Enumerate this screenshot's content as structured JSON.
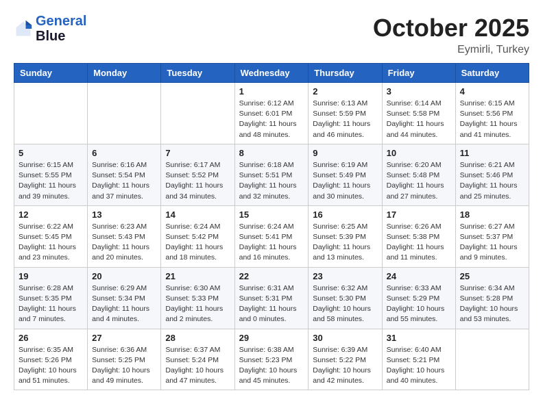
{
  "header": {
    "logo_line1": "General",
    "logo_line2": "Blue",
    "month": "October 2025",
    "location": "Eymirli, Turkey"
  },
  "weekdays": [
    "Sunday",
    "Monday",
    "Tuesday",
    "Wednesday",
    "Thursday",
    "Friday",
    "Saturday"
  ],
  "weeks": [
    [
      {
        "day": "",
        "info": ""
      },
      {
        "day": "",
        "info": ""
      },
      {
        "day": "",
        "info": ""
      },
      {
        "day": "1",
        "info": "Sunrise: 6:12 AM\nSunset: 6:01 PM\nDaylight: 11 hours and 48 minutes."
      },
      {
        "day": "2",
        "info": "Sunrise: 6:13 AM\nSunset: 5:59 PM\nDaylight: 11 hours and 46 minutes."
      },
      {
        "day": "3",
        "info": "Sunrise: 6:14 AM\nSunset: 5:58 PM\nDaylight: 11 hours and 44 minutes."
      },
      {
        "day": "4",
        "info": "Sunrise: 6:15 AM\nSunset: 5:56 PM\nDaylight: 11 hours and 41 minutes."
      }
    ],
    [
      {
        "day": "5",
        "info": "Sunrise: 6:15 AM\nSunset: 5:55 PM\nDaylight: 11 hours and 39 minutes."
      },
      {
        "day": "6",
        "info": "Sunrise: 6:16 AM\nSunset: 5:54 PM\nDaylight: 11 hours and 37 minutes."
      },
      {
        "day": "7",
        "info": "Sunrise: 6:17 AM\nSunset: 5:52 PM\nDaylight: 11 hours and 34 minutes."
      },
      {
        "day": "8",
        "info": "Sunrise: 6:18 AM\nSunset: 5:51 PM\nDaylight: 11 hours and 32 minutes."
      },
      {
        "day": "9",
        "info": "Sunrise: 6:19 AM\nSunset: 5:49 PM\nDaylight: 11 hours and 30 minutes."
      },
      {
        "day": "10",
        "info": "Sunrise: 6:20 AM\nSunset: 5:48 PM\nDaylight: 11 hours and 27 minutes."
      },
      {
        "day": "11",
        "info": "Sunrise: 6:21 AM\nSunset: 5:46 PM\nDaylight: 11 hours and 25 minutes."
      }
    ],
    [
      {
        "day": "12",
        "info": "Sunrise: 6:22 AM\nSunset: 5:45 PM\nDaylight: 11 hours and 23 minutes."
      },
      {
        "day": "13",
        "info": "Sunrise: 6:23 AM\nSunset: 5:43 PM\nDaylight: 11 hours and 20 minutes."
      },
      {
        "day": "14",
        "info": "Sunrise: 6:24 AM\nSunset: 5:42 PM\nDaylight: 11 hours and 18 minutes."
      },
      {
        "day": "15",
        "info": "Sunrise: 6:24 AM\nSunset: 5:41 PM\nDaylight: 11 hours and 16 minutes."
      },
      {
        "day": "16",
        "info": "Sunrise: 6:25 AM\nSunset: 5:39 PM\nDaylight: 11 hours and 13 minutes."
      },
      {
        "day": "17",
        "info": "Sunrise: 6:26 AM\nSunset: 5:38 PM\nDaylight: 11 hours and 11 minutes."
      },
      {
        "day": "18",
        "info": "Sunrise: 6:27 AM\nSunset: 5:37 PM\nDaylight: 11 hours and 9 minutes."
      }
    ],
    [
      {
        "day": "19",
        "info": "Sunrise: 6:28 AM\nSunset: 5:35 PM\nDaylight: 11 hours and 7 minutes."
      },
      {
        "day": "20",
        "info": "Sunrise: 6:29 AM\nSunset: 5:34 PM\nDaylight: 11 hours and 4 minutes."
      },
      {
        "day": "21",
        "info": "Sunrise: 6:30 AM\nSunset: 5:33 PM\nDaylight: 11 hours and 2 minutes."
      },
      {
        "day": "22",
        "info": "Sunrise: 6:31 AM\nSunset: 5:31 PM\nDaylight: 11 hours and 0 minutes."
      },
      {
        "day": "23",
        "info": "Sunrise: 6:32 AM\nSunset: 5:30 PM\nDaylight: 10 hours and 58 minutes."
      },
      {
        "day": "24",
        "info": "Sunrise: 6:33 AM\nSunset: 5:29 PM\nDaylight: 10 hours and 55 minutes."
      },
      {
        "day": "25",
        "info": "Sunrise: 6:34 AM\nSunset: 5:28 PM\nDaylight: 10 hours and 53 minutes."
      }
    ],
    [
      {
        "day": "26",
        "info": "Sunrise: 6:35 AM\nSunset: 5:26 PM\nDaylight: 10 hours and 51 minutes."
      },
      {
        "day": "27",
        "info": "Sunrise: 6:36 AM\nSunset: 5:25 PM\nDaylight: 10 hours and 49 minutes."
      },
      {
        "day": "28",
        "info": "Sunrise: 6:37 AM\nSunset: 5:24 PM\nDaylight: 10 hours and 47 minutes."
      },
      {
        "day": "29",
        "info": "Sunrise: 6:38 AM\nSunset: 5:23 PM\nDaylight: 10 hours and 45 minutes."
      },
      {
        "day": "30",
        "info": "Sunrise: 6:39 AM\nSunset: 5:22 PM\nDaylight: 10 hours and 42 minutes."
      },
      {
        "day": "31",
        "info": "Sunrise: 6:40 AM\nSunset: 5:21 PM\nDaylight: 10 hours and 40 minutes."
      },
      {
        "day": "",
        "info": ""
      }
    ]
  ]
}
